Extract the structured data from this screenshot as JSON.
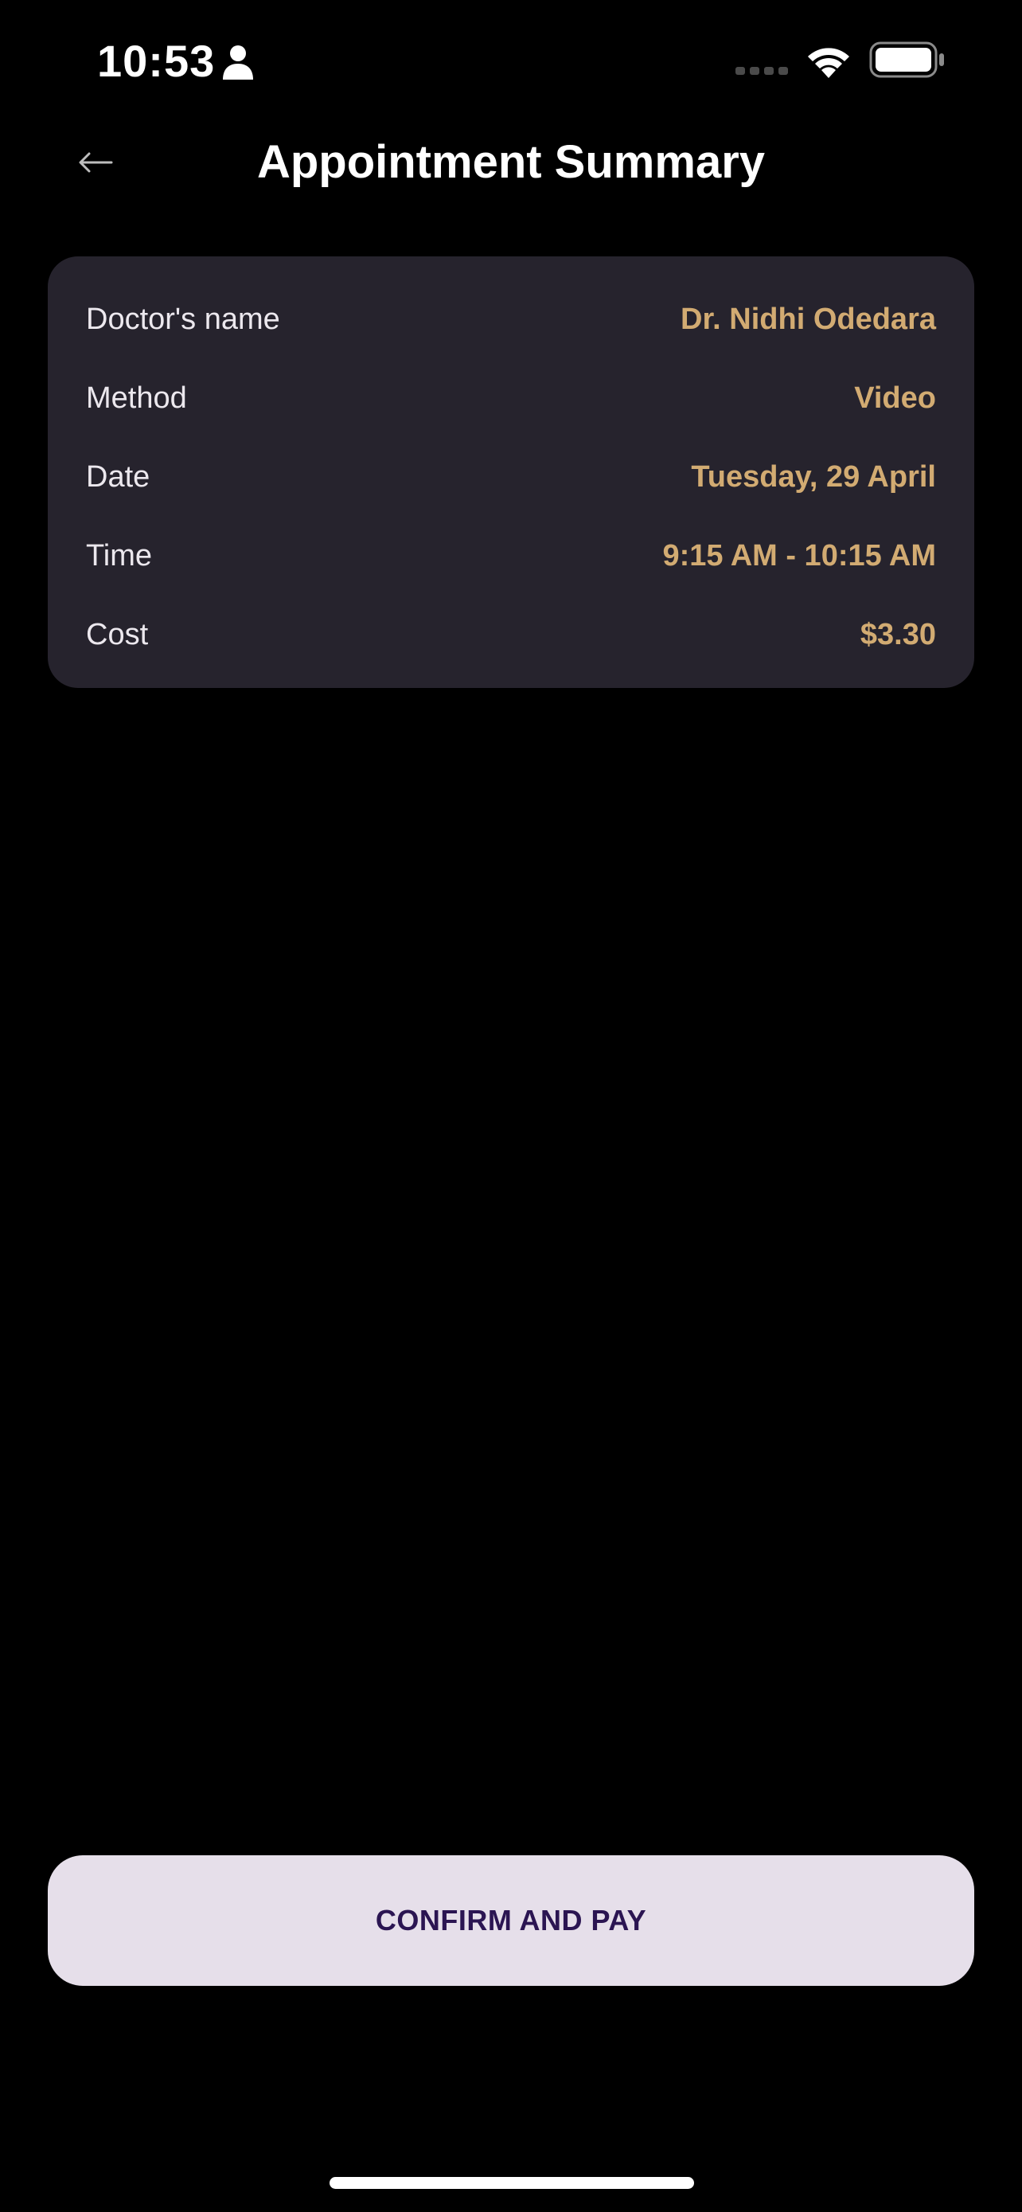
{
  "status_bar": {
    "time": "10:53",
    "icons": [
      "person-icon",
      "signal-icon",
      "wifi-icon",
      "battery-icon"
    ]
  },
  "header": {
    "back_icon": "arrow-left-icon",
    "title": "Appointment Summary"
  },
  "summary": {
    "rows": [
      {
        "label": "Doctor's name",
        "value": "Dr. Nidhi Odedara"
      },
      {
        "label": "Method",
        "value": "Video"
      },
      {
        "label": "Date",
        "value": "Tuesday, 29 April"
      },
      {
        "label": "Time",
        "value": "9:15 AM - 10:15 AM"
      },
      {
        "label": "Cost",
        "value": "$3.30"
      }
    ]
  },
  "actions": {
    "confirm_label": "CONFIRM AND PAY"
  },
  "colors": {
    "background": "#000000",
    "card": "#26232d",
    "value_accent": "#d2ab72",
    "button_bg": "#e6dfea",
    "button_text": "#2b1552"
  }
}
